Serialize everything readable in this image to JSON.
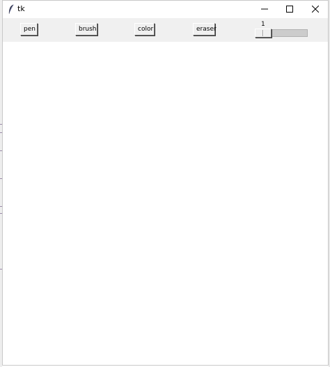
{
  "window": {
    "title": "tk",
    "icon": "feather-icon",
    "controls": {
      "minimize_icon": "minimize-icon",
      "maximize_icon": "maximize-icon",
      "close_icon": "close-icon"
    }
  },
  "toolbar": {
    "pen_label": "pen",
    "brush_label": "brush",
    "color_label": "color",
    "eraser_label": "eraser",
    "size_scale": {
      "value": "1",
      "min": 1,
      "max": 10
    }
  },
  "colors": {
    "toolbar_bg": "#f0f0f0",
    "canvas_bg": "#ffffff",
    "trough": "#cccccc"
  }
}
